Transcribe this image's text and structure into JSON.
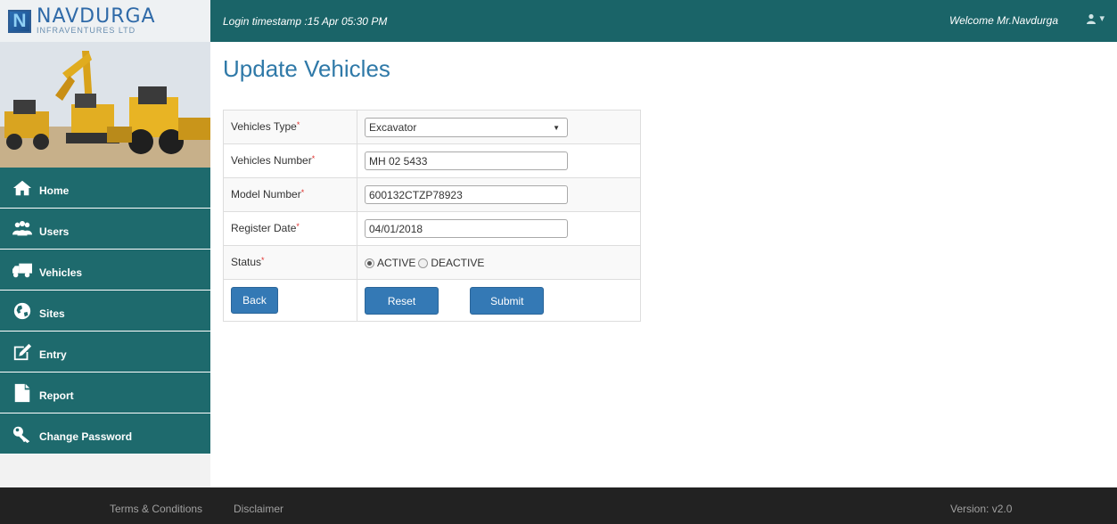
{
  "brand": {
    "name": "NAVDURGA",
    "sub": "INFRAVENTURES LTD",
    "mark": "N"
  },
  "header": {
    "login_timestamp": "Login timestamp :15 Apr 05:30 PM",
    "welcome": "Welcome Mr.Navdurga",
    "user_icon": "user-icon",
    "caret": "▾"
  },
  "sidebar": {
    "items": [
      {
        "label": "Home",
        "icon": "home-icon"
      },
      {
        "label": "Users",
        "icon": "users-icon"
      },
      {
        "label": "Vehicles",
        "icon": "truck-icon"
      },
      {
        "label": "Sites",
        "icon": "globe-icon"
      },
      {
        "label": "Entry",
        "icon": "edit-icon"
      },
      {
        "label": "Report",
        "icon": "file-icon"
      },
      {
        "label": "Change Password",
        "icon": "key-icon"
      }
    ]
  },
  "main": {
    "title": "Update Vehicles",
    "form": {
      "required_mark": "*",
      "vehicle_type_label": "Vehicles Type",
      "vehicle_type_value": "Excavator",
      "vehicle_number_label": "Vehicles Number",
      "vehicle_number_value": "MH 02 5433",
      "model_number_label": "Model Number",
      "model_number_value": "600132CTZP78923",
      "register_date_label": "Register Date",
      "register_date_value": "04/01/2018",
      "status_label": "Status",
      "status_options": [
        "ACTIVE",
        "DEACTIVE"
      ],
      "status_selected": "ACTIVE",
      "back_label": "Back",
      "reset_label": "Reset",
      "submit_label": "Submit"
    }
  },
  "footer": {
    "terms": "Terms & Conditions",
    "disclaimer": "Disclaimer",
    "version": "Version: v2.0"
  },
  "colors": {
    "topbar": "#1a6468",
    "sidebar_item": "#1e6a6d",
    "title": "#2f79a8",
    "button": "#3479b5",
    "footer": "#222222"
  }
}
